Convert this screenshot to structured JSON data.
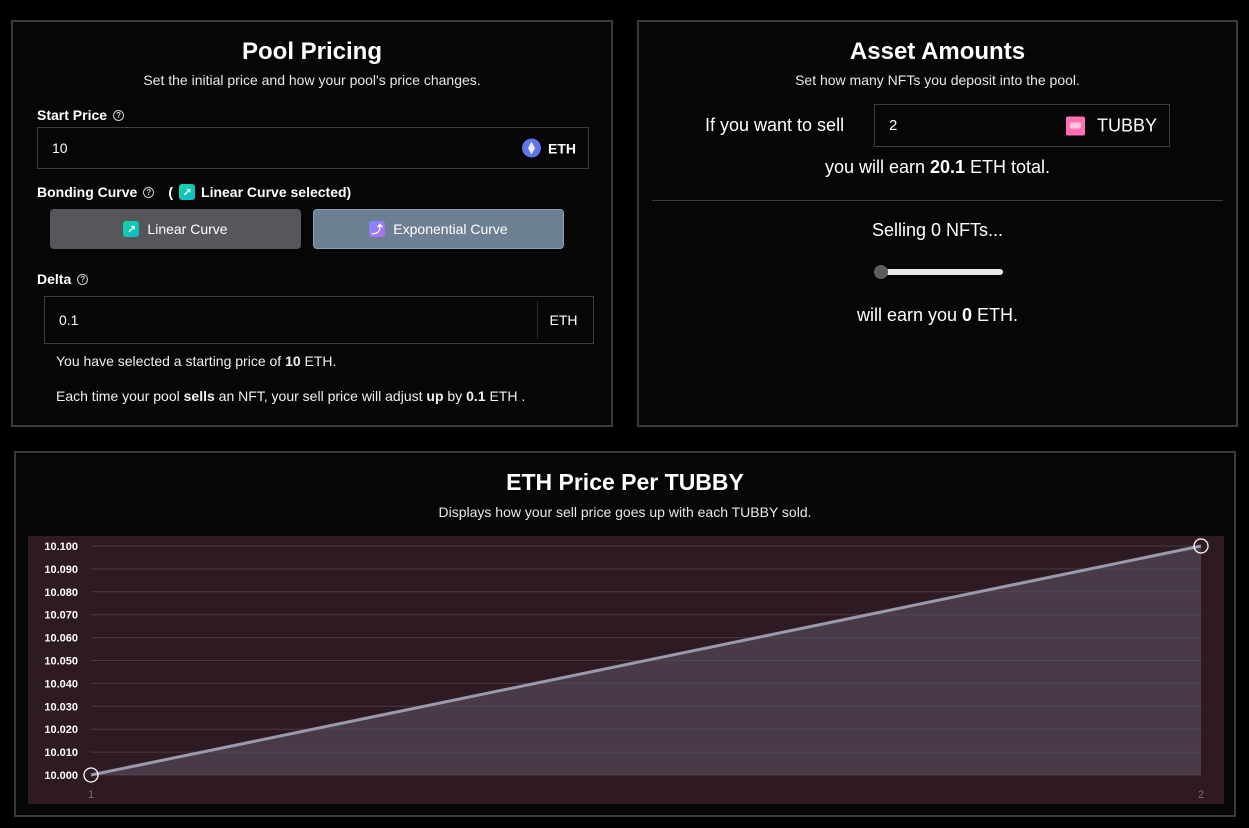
{
  "pool": {
    "title": "Pool Pricing",
    "subtitle": "Set the initial price and how your pool's price changes.",
    "start_price_label": "Start Price",
    "start_price_value": "10",
    "currency": "ETH",
    "bonding_curve_label": "Bonding Curve",
    "open_paren": "(",
    "selected_curve_text": "Linear Curve selected)",
    "linear_button": "Linear Curve",
    "exponential_button": "Exponential Curve",
    "delta_label": "Delta",
    "delta_value": "0.1",
    "delta_currency": "ETH",
    "summary1": {
      "pre": "You have selected a starting price of ",
      "value": "10",
      "post": " ETH."
    },
    "summary2": {
      "a": "Each time your pool ",
      "b": "sells",
      "c": " an NFT, your sell price will adjust ",
      "d": "up",
      "e": " by ",
      "f": "0.1",
      "g": " ETH ."
    }
  },
  "asset": {
    "title": "Asset Amounts",
    "subtitle": "Set how many NFTs you deposit into the pool.",
    "sell_prompt": "If you want to sell",
    "sell_amount": "2",
    "token": "TUBBY",
    "earn_pre": "you will earn ",
    "earn_value": "20.1",
    "earn_post": " ETH total.",
    "selling_text": "Selling 0 NFTs...",
    "slider_value": 0,
    "will_earn_pre": "will earn you ",
    "will_earn_value": "0",
    "will_earn_post": " ETH."
  },
  "chart_header": {
    "title": "ETH Price Per TUBBY",
    "subtitle": "Displays how your sell price goes up with each TUBBY sold."
  },
  "chart_data": {
    "type": "area",
    "x": [
      1,
      2
    ],
    "values": [
      10.0,
      10.1
    ],
    "ylim": [
      10.0,
      10.1
    ],
    "yticks": [
      "10.100",
      "10.090",
      "10.080",
      "10.070",
      "10.060",
      "10.050",
      "10.040",
      "10.030",
      "10.020",
      "10.010",
      "10.000"
    ],
    "xticks": [
      "1",
      "2"
    ],
    "grid": true,
    "colors": {
      "background": "#2e1a22",
      "line": "#9a9aae",
      "fill": "#5a5060",
      "grid": "#4a3a40"
    }
  }
}
